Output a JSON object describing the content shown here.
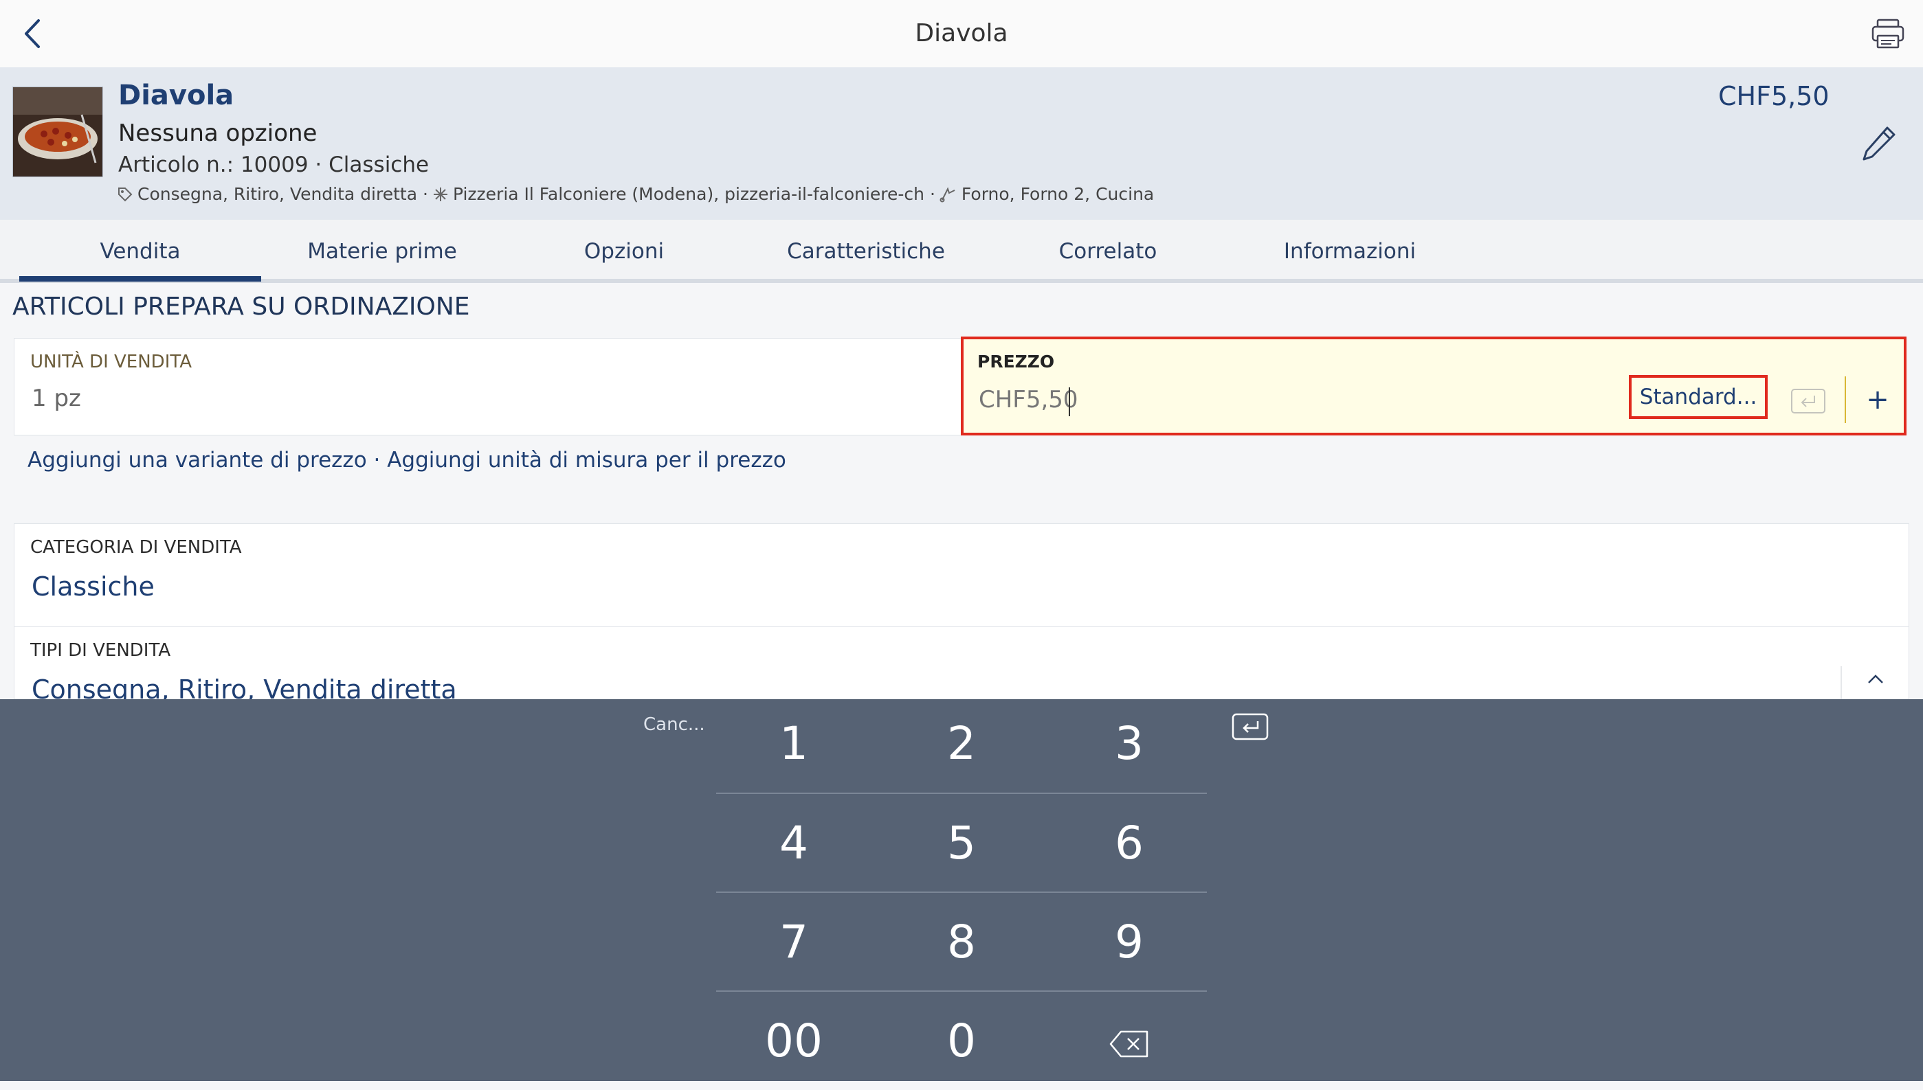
{
  "navbar": {
    "title": "Diavola"
  },
  "header": {
    "title": "Diavola",
    "option": "Nessuna opzione",
    "article": "Articolo n.: 10009 · Classiche",
    "meta_sales": "Consegna, Ritiro, Vendita diretta ·",
    "meta_store": "Pizzeria Il Falconiere (Modena), pizzeria-il-falconiere-ch ·",
    "meta_print": "Forno, Forno 2, Cucina",
    "price": "CHF5,50"
  },
  "tabs": [
    {
      "label": "Vendita"
    },
    {
      "label": "Materie prime"
    },
    {
      "label": "Opzioni"
    },
    {
      "label": "Caratteristiche"
    },
    {
      "label": "Correlato"
    },
    {
      "label": "Informazioni"
    }
  ],
  "section": {
    "title": "ARTICOLI PREPARA SU ORDINAZIONE",
    "unit_label": "UNITÀ DI VENDITA",
    "unit_value": "1 pz",
    "price_label": "PREZZO",
    "price_value": "CHF5,50",
    "standard_button": "Standard...",
    "plus_label": "+",
    "link_variant": "Aggiungi una variante di prezzo",
    "link_sep": " · ",
    "link_unit": "Aggiungi unità di misura per il prezzo",
    "category_label": "CATEGORIA DI VENDITA",
    "category_value": "Classiche",
    "types_label": "TIPI DI VENDITA",
    "types_value": "Consegna, Ritiro, Vendita diretta"
  },
  "keypad": {
    "cancel": "Canc...",
    "keys": [
      "1",
      "2",
      "3",
      "4",
      "5",
      "6",
      "7",
      "8",
      "9",
      "00",
      "0"
    ]
  },
  "colors": {
    "accent": "#1f3f73",
    "highlight": "#e02a1e",
    "keypad_bg": "#566274",
    "field_bg": "#fffde6"
  },
  "icons": [
    "back-icon",
    "printer-icon",
    "edit-icon",
    "tag-icon",
    "store-icon",
    "printer-route-icon",
    "return-icon",
    "backspace-icon",
    "chevron-up-icon"
  ]
}
